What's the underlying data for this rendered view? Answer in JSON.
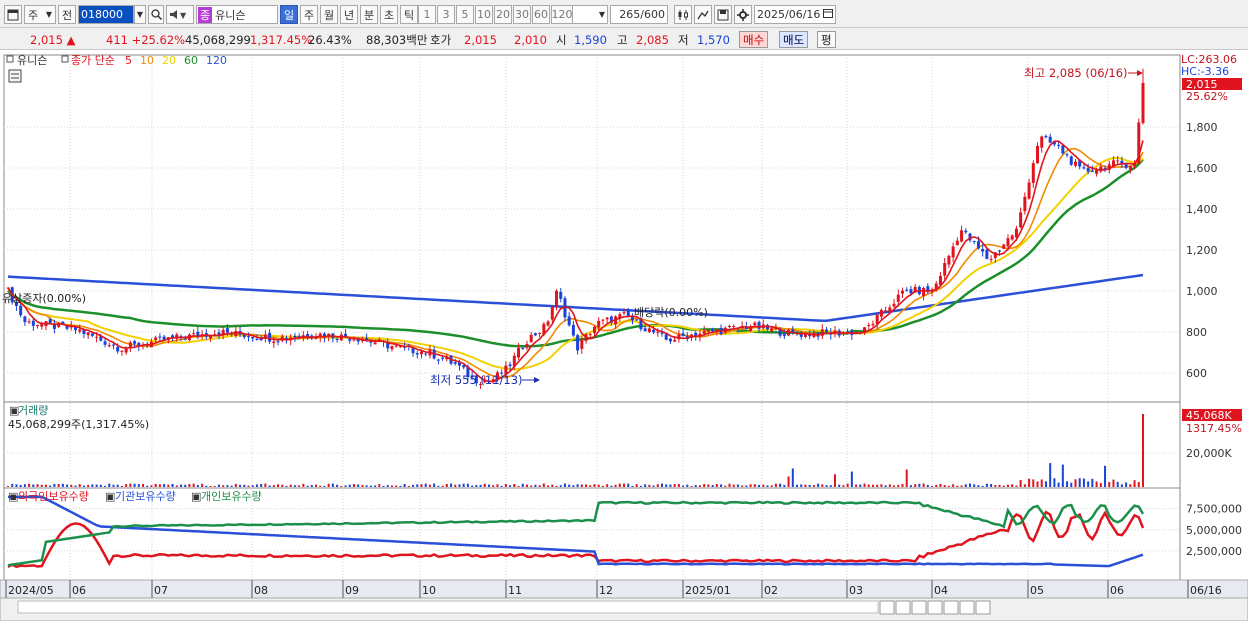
{
  "toolbar": {
    "type_label": "주",
    "prev_label": "전",
    "code": "018000",
    "stock_badge": "종",
    "stock_name": "유니슨",
    "periods": [
      "일",
      "주",
      "월",
      "년",
      "분",
      "초",
      "틱"
    ],
    "intervals": [
      "1",
      "3",
      "5",
      "10",
      "20",
      "30",
      "60",
      "120"
    ],
    "count": "265",
    "count_total": "/600",
    "date": "2025/06/16"
  },
  "quote": {
    "price": "2,015",
    "change_arrow": "▲",
    "change": "411",
    "change_pct": "+25.62%",
    "volume": "45,068,299",
    "volume_pct": "1,317.45%",
    "turnover": "26.43%",
    "amount": "88,303백만",
    "bid_label": "호가",
    "bid": "2,015",
    "ask": "2,010",
    "open_label": "시",
    "open": "1,590",
    "high_label": "고",
    "high": "2,085",
    "low_label": "저",
    "low": "1,570",
    "buy_label": "매수",
    "sell_label": "매도",
    "eval_label": "평"
  },
  "price_panel": {
    "name_tag": "유니슨",
    "legend_prefix": "종가 단순",
    "ma": [
      {
        "period": "5",
        "color": "#e0141e"
      },
      {
        "period": "10",
        "color": "#f08a00"
      },
      {
        "period": "20",
        "color": "#f2d100"
      },
      {
        "period": "60",
        "color": "#1c8f2a"
      },
      {
        "period": "120",
        "color": "#2a4fd8"
      }
    ],
    "lc_label": "LC:263.06",
    "hc_label": "HC:-3.36",
    "current_price_tag": "2,015",
    "current_pct": "25.62%",
    "y_ticks": [
      "1,800",
      "1,600",
      "1,400",
      "1,200",
      "1,000",
      "800",
      "600"
    ],
    "high_annotation": "최고 2,085 (06/16)",
    "low_annotation": "최저 555 (11/13)",
    "event_left": "유상증자(0.00%)",
    "event_mid": "배당락(0.00%)"
  },
  "volume_panel": {
    "title": "거래량",
    "subtitle": "45,068,299주(1,317.45%)",
    "tag": "45,068K",
    "tag_pct": "1317.45%",
    "y_tick": "20,000K"
  },
  "holding_panel": {
    "series": [
      {
        "name": "외국인보유수량",
        "color": "#e0141e"
      },
      {
        "name": "기관보유수량",
        "color": "#2a4fd8"
      },
      {
        "name": "개인보유수량",
        "color": "#1c8f4a"
      }
    ],
    "y_ticks": [
      "7,500,000",
      "5,000,000",
      "2,500,000"
    ]
  },
  "x_axis": [
    "2024/05",
    "06",
    "07",
    "08",
    "09",
    "10",
    "11",
    "12",
    "2025/01",
    "02",
    "03",
    "04",
    "05",
    "06",
    "06/16"
  ],
  "colors": {
    "up": "#e0141e",
    "down": "#1a43d8",
    "grid": "#c8c8c8",
    "panel_bg": "#ffffff"
  }
}
